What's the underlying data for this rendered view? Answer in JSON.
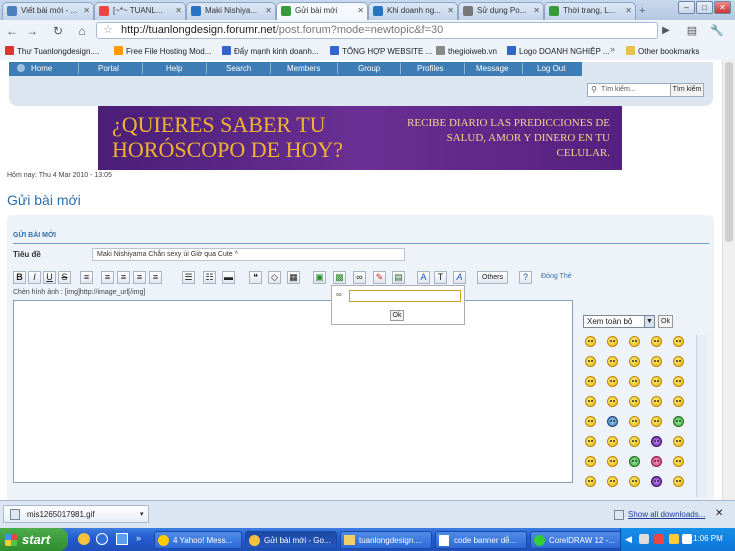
{
  "browser": {
    "tabs": [
      {
        "title": "Viết bài mới - ..."
      },
      {
        "title": "[~*~ TUANL..."
      },
      {
        "title": "Maki Nishiya..."
      },
      {
        "title": "Gửi bài mới"
      },
      {
        "title": "Khi doanh ng..."
      },
      {
        "title": "Sử dụng Po..."
      },
      {
        "title": "Thời trang, L..."
      }
    ],
    "url_domain": "http://tuanlongdesign.forumr.net",
    "url_path": "/post.forum?mode=newtopic&f=30",
    "bookmarks": [
      "Thư Tuanlongdesign....",
      "Free File Hosting Mod...",
      "Đẩy mạnh kinh doanh...",
      "TỔNG HỢP WEBSITE ...",
      "thegioiweb.vn",
      "Logo DOANH NGHIỆP ..."
    ],
    "other_bookmarks": "Other bookmarks"
  },
  "forum": {
    "nav": [
      "Home",
      "Portal",
      "Help",
      "Search",
      "Members",
      "Group",
      "Profiles",
      "Message",
      "Log Out"
    ],
    "search_placeholder": "Tìm kiếm...",
    "search_button": "Tìm kiếm",
    "banner": {
      "line1": "¿QUIERES SABER TU",
      "line2": "HORÓSCOPO DE HOY?",
      "side": "RECIBE DIARIO LAS PREDICCIONES DE SALUD, AMOR Y DINERO EN TU CELULAR."
    },
    "datetime": "Hôm nay: Thu 4 Mar 2010 - 13:05",
    "page_title": "Gửi bài mới"
  },
  "post": {
    "header": "GỬI BÀI MỚI",
    "subject_label": "Tiêu đề",
    "subject_value": "Maki Nishiyama Chắn sexy úi Giờ qua Cute ^",
    "toolbar": {
      "bold": "B",
      "italic": "I",
      "underline": "U",
      "strike": "S",
      "others": "Others",
      "dongthe": "Đóng Thẻ"
    },
    "image_hint": "Chèn hình ảnh : [img]http://image_url[/img]",
    "popup_ok": "Ok",
    "smiley_select": "Xem toàn bộ",
    "smiley_ok": "Ok"
  },
  "downloads": {
    "file": "mis1265017981.gif",
    "show_all": "Show all downloads..."
  },
  "taskbar": {
    "start": "start",
    "tasks": [
      "4 Yahoo! Mess...",
      "Gửi bài mới - Go...",
      "tuanlongdesign....",
      "code banner dễ...",
      "CorelDRAW 12 -..."
    ],
    "clock": "1:06 PM"
  },
  "colors": {
    "accent": "#3d7cb4",
    "title": "#2f6ea8",
    "banner_text": "#f0b430"
  }
}
